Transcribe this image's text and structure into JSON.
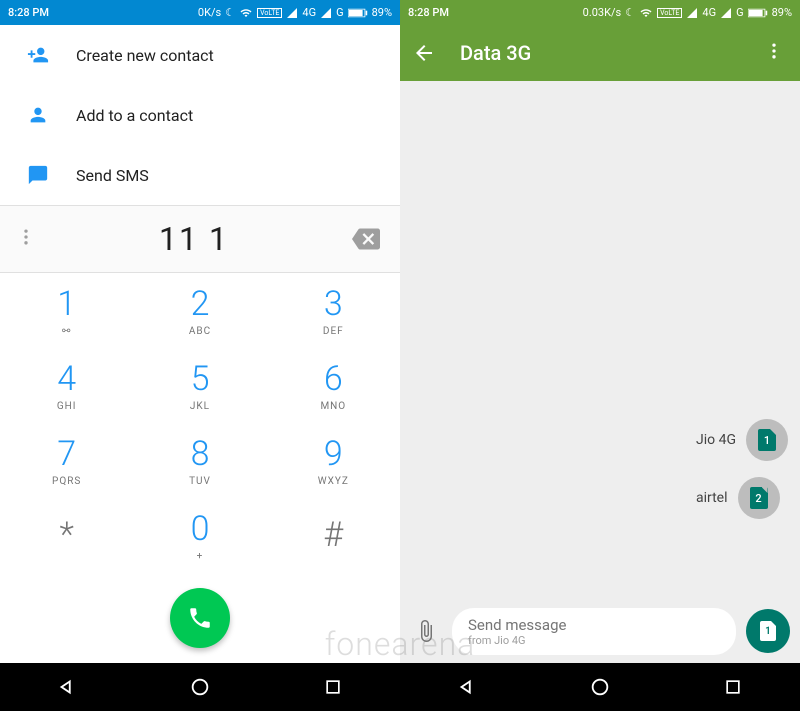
{
  "status": {
    "time": "8:28 PM",
    "speed_left": "0K/s",
    "speed_right": "0.03K/s",
    "net1": "4G",
    "net2": "G",
    "battery": "89%"
  },
  "dialer": {
    "create_contact": "Create new contact",
    "add_contact": "Add to a contact",
    "send_sms": "Send SMS",
    "entered": "11 1",
    "keys": {
      "k1": {
        "d": "1",
        "s": "⚯"
      },
      "k2": {
        "d": "2",
        "s": "ABC"
      },
      "k3": {
        "d": "3",
        "s": "DEF"
      },
      "k4": {
        "d": "4",
        "s": "GHI"
      },
      "k5": {
        "d": "5",
        "s": "JKL"
      },
      "k6": {
        "d": "6",
        "s": "MNO"
      },
      "k7": {
        "d": "7",
        "s": "PQRS"
      },
      "k8": {
        "d": "8",
        "s": "TUV"
      },
      "k9": {
        "d": "9",
        "s": "WXYZ"
      },
      "kstar": {
        "d": "*",
        "s": ""
      },
      "k0": {
        "d": "0",
        "s": "+"
      },
      "khash": {
        "d": "#",
        "s": ""
      }
    }
  },
  "messages": {
    "title": "Data 3G",
    "sim1": "Jio 4G",
    "sim1_num": "1",
    "sim2": "airtel",
    "sim2_num": "2",
    "compose_placeholder": "Send message",
    "compose_sub": "from Jio 4G",
    "send_num": "1"
  },
  "watermark": "fonearena"
}
